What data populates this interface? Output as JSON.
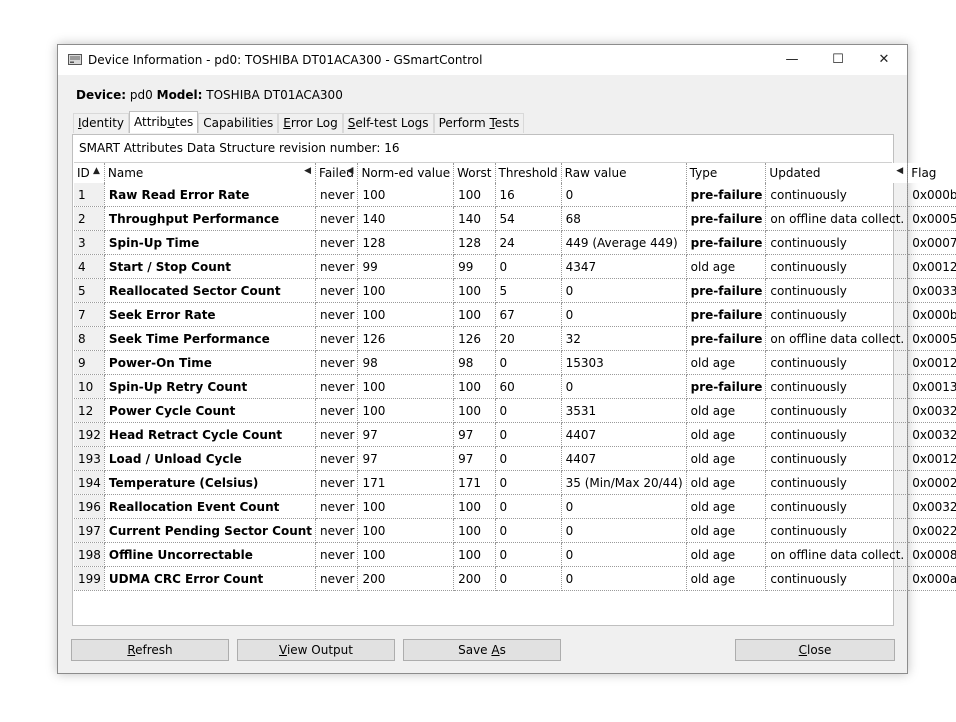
{
  "window": {
    "title": "Device Information - pd0: TOSHIBA DT01ACA300 - GSmartControl",
    "controls": {
      "minimize": "—",
      "maximize": "☐",
      "close": "✕"
    }
  },
  "device": {
    "device_label": "Device:",
    "device_value": "pd0",
    "model_label": "Model:",
    "model_value": "TOSHIBA DT01ACA300"
  },
  "tabs": [
    {
      "pre": "",
      "key": "I",
      "post": "dentity"
    },
    {
      "pre": "Attrib",
      "key": "u",
      "post": "tes"
    },
    {
      "pre": "Capabilities",
      "key": "",
      "post": ""
    },
    {
      "pre": "",
      "key": "E",
      "post": "rror Log"
    },
    {
      "pre": "",
      "key": "S",
      "post": "elf-test Logs"
    },
    {
      "pre": "Perform ",
      "key": "T",
      "post": "ests"
    }
  ],
  "revision_text": "SMART Attributes Data Structure revision number: 16",
  "columns": [
    {
      "label": "ID",
      "arrow": "▲"
    },
    {
      "label": "Name",
      "arrow": "◀"
    },
    {
      "label": "Failed",
      "arrow": "◀"
    },
    {
      "label": "Norm-ed value",
      "arrow": ""
    },
    {
      "label": "Worst",
      "arrow": ""
    },
    {
      "label": "Threshold",
      "arrow": ""
    },
    {
      "label": "Raw value",
      "arrow": ""
    },
    {
      "label": "Type",
      "arrow": ""
    },
    {
      "label": "Updated",
      "arrow": "◀"
    },
    {
      "label": "Flag",
      "arrow": ""
    }
  ],
  "rows": [
    [
      "1",
      "Raw Read Error Rate",
      "never",
      "100",
      "100",
      "16",
      "0",
      "pre-failure",
      "continuously",
      "0x000b"
    ],
    [
      "2",
      "Throughput Performance",
      "never",
      "140",
      "140",
      "54",
      "68",
      "pre-failure",
      "on offline data collect.",
      "0x0005"
    ],
    [
      "3",
      "Spin-Up Time",
      "never",
      "128",
      "128",
      "24",
      "449 (Average 449)",
      "pre-failure",
      "continuously",
      "0x0007"
    ],
    [
      "4",
      "Start / Stop Count",
      "never",
      "99",
      "99",
      "0",
      "4347",
      "old age",
      "continuously",
      "0x0012"
    ],
    [
      "5",
      "Reallocated Sector Count",
      "never",
      "100",
      "100",
      "5",
      "0",
      "pre-failure",
      "continuously",
      "0x0033"
    ],
    [
      "7",
      "Seek Error Rate",
      "never",
      "100",
      "100",
      "67",
      "0",
      "pre-failure",
      "continuously",
      "0x000b"
    ],
    [
      "8",
      "Seek Time Performance",
      "never",
      "126",
      "126",
      "20",
      "32",
      "pre-failure",
      "on offline data collect.",
      "0x0005"
    ],
    [
      "9",
      "Power-On Time",
      "never",
      "98",
      "98",
      "0",
      "15303",
      "old age",
      "continuously",
      "0x0012"
    ],
    [
      "10",
      "Spin-Up Retry Count",
      "never",
      "100",
      "100",
      "60",
      "0",
      "pre-failure",
      "continuously",
      "0x0013"
    ],
    [
      "12",
      "Power Cycle Count",
      "never",
      "100",
      "100",
      "0",
      "3531",
      "old age",
      "continuously",
      "0x0032"
    ],
    [
      "192",
      "Head Retract Cycle Count",
      "never",
      "97",
      "97",
      "0",
      "4407",
      "old age",
      "continuously",
      "0x0032"
    ],
    [
      "193",
      "Load / Unload Cycle",
      "never",
      "97",
      "97",
      "0",
      "4407",
      "old age",
      "continuously",
      "0x0012"
    ],
    [
      "194",
      "Temperature (Celsius)",
      "never",
      "171",
      "171",
      "0",
      "35 (Min/Max 20/44)",
      "old age",
      "continuously",
      "0x0002"
    ],
    [
      "196",
      "Reallocation Event Count",
      "never",
      "100",
      "100",
      "0",
      "0",
      "old age",
      "continuously",
      "0x0032"
    ],
    [
      "197",
      "Current Pending Sector Count",
      "never",
      "100",
      "100",
      "0",
      "0",
      "old age",
      "continuously",
      "0x0022"
    ],
    [
      "198",
      "Offline Uncorrectable",
      "never",
      "100",
      "100",
      "0",
      "0",
      "old age",
      "on offline data collect.",
      "0x0008"
    ],
    [
      "199",
      "UDMA CRC Error Count",
      "never",
      "200",
      "200",
      "0",
      "0",
      "old age",
      "continuously",
      "0x000a"
    ]
  ],
  "buttons": {
    "refresh": {
      "pre": "",
      "key": "R",
      "post": "efresh"
    },
    "view_output": {
      "pre": "",
      "key": "V",
      "post": "iew Output"
    },
    "save_as": {
      "pre": "Save ",
      "key": "A",
      "post": "s"
    },
    "close": {
      "pre": "",
      "key": "C",
      "post": "lose"
    }
  }
}
